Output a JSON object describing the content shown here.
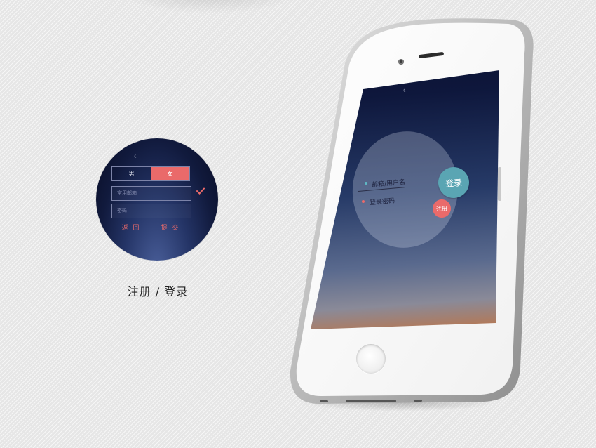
{
  "preview": {
    "gender": {
      "male": "男",
      "female": "女",
      "selected": "female"
    },
    "email_placeholder": "常用邮箱",
    "password_placeholder": "密码",
    "back_label": "返 回",
    "submit_label": "提 交",
    "check_icon": "check-icon"
  },
  "caption": "注册 / 登录",
  "phone_screen": {
    "username_label": "邮箱/用户名",
    "password_label": "登录密码",
    "login_label": "登录",
    "register_label": "注册"
  },
  "colors": {
    "accent_red": "#ea6a6a",
    "accent_teal": "#5aa5b3",
    "night_sky": "#0e173c"
  }
}
